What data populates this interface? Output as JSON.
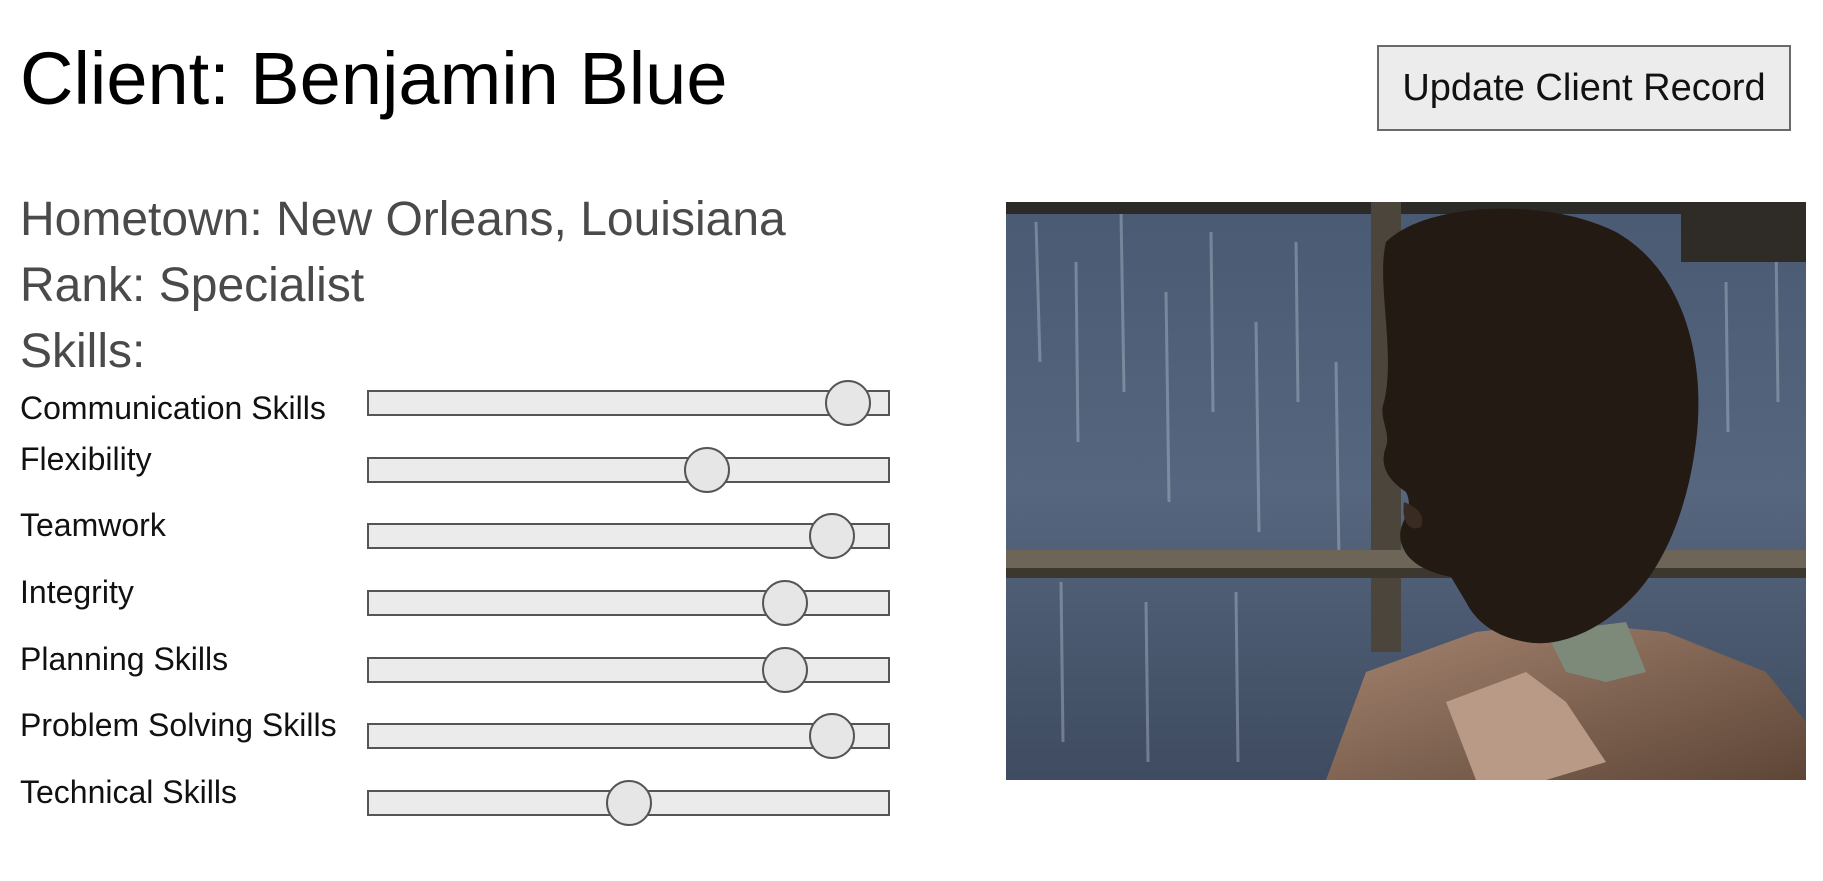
{
  "client": {
    "title": "Client: Benjamin Blue"
  },
  "actions": {
    "update_label": "Update Client Record"
  },
  "info": {
    "hometown": "Hometown: New Orleans, Louisiana",
    "rank": "Rank: Specialist",
    "skills_heading": "Skills:"
  },
  "skills": [
    {
      "name": "Communication Skills",
      "level": 0.92
    },
    {
      "name": "Flexibility",
      "level": 0.65
    },
    {
      "name": "Teamwork",
      "level": 0.89
    },
    {
      "name": "Integrity",
      "level": 0.8
    },
    {
      "name": "Planning Skills",
      "level": 0.8
    },
    {
      "name": "Problem Solving Skills",
      "level": 0.89
    },
    {
      "name": "Technical Skills",
      "level": 0.5
    }
  ],
  "colors": {
    "button_bg": "#ececec",
    "slider_track": "#ebebeb",
    "info_text": "#4a4a4a"
  },
  "photo": {
    "subject": "client-portrait"
  }
}
